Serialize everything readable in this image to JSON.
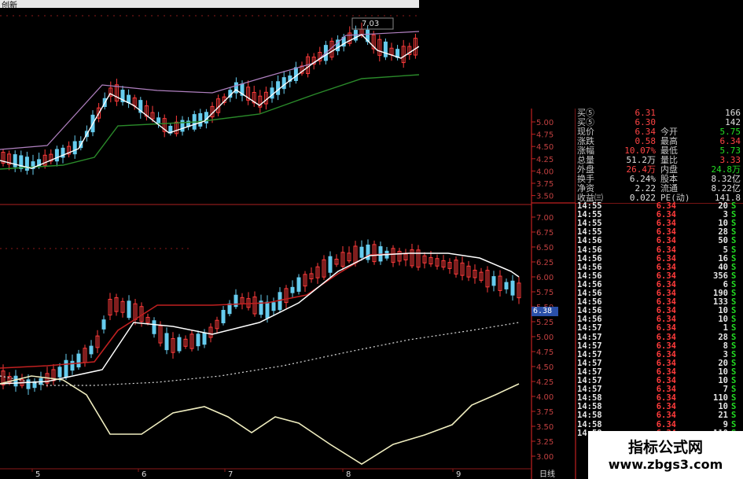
{
  "window": {
    "title": "创新"
  },
  "colors": {
    "up": "#ff3b3b",
    "down": "#66ccee",
    "ma_white": "#ffffff",
    "ma_purple": "#b080c0",
    "ma_green": "#2a8a2a",
    "ma_red": "#c02020",
    "oscillator": "#f0eec0",
    "grid": "#8b1a1a"
  },
  "top_chart": {
    "annotation": "7.03",
    "y_ticks": [
      "5.00",
      "4.75",
      "4.50",
      "4.25",
      "4.00",
      "3.75",
      "3.50"
    ]
  },
  "main_chart": {
    "y_ticks": [
      "7.00",
      "6.75",
      "6.50",
      "6.25",
      "6.00",
      "5.75",
      "5.50",
      "5.25",
      "5.00",
      "4.75",
      "4.50",
      "4.25",
      "4.00",
      "3.75",
      "3.50",
      "3.25",
      "3.00"
    ],
    "price_tag": "6.38",
    "x_labels": [
      "5",
      "6",
      "7",
      "8",
      "9"
    ],
    "period_label": "日线"
  },
  "quote": {
    "rows": [
      {
        "l1": "买⑤",
        "v1": "6.31",
        "v1c": "qv",
        "l2": "",
        "v2": "166",
        "v2c": "qw"
      },
      {
        "l1": "买⑤",
        "v1": "6.30",
        "v1c": "qv",
        "l2": "",
        "v2": "142",
        "v2c": "qw"
      },
      {
        "l1": "现价",
        "v1": "6.34",
        "v1c": "qv",
        "l2": "今开",
        "v2": "5.75",
        "v2c": "qg"
      },
      {
        "l1": "涨跌",
        "v1": "0.58",
        "v1c": "qv",
        "l2": "最高",
        "v2": "6.34",
        "v2c": "qv"
      },
      {
        "l1": "涨幅",
        "v1": "10.07%",
        "v1c": "qv",
        "l2": "最低",
        "v2": "5.73",
        "v2c": "qg"
      },
      {
        "l1": "总量",
        "v1": "51.2万",
        "v1c": "qw",
        "l2": "量比",
        "v2": "3.33",
        "v2c": "qv"
      },
      {
        "l1": "外盘",
        "v1": "26.4万",
        "v1c": "qv",
        "l2": "内盘",
        "v2": "24.8万",
        "v2c": "qg"
      },
      {
        "l1": "换手",
        "v1": "6.24%",
        "v1c": "qw",
        "l2": "股本",
        "v2": "8.32亿",
        "v2c": "qw"
      },
      {
        "l1": "净资",
        "v1": "2.22",
        "v1c": "qw",
        "l2": "流通",
        "v2": "8.22亿",
        "v2c": "qw"
      },
      {
        "l1": "收益㈢",
        "v1": "0.022",
        "v1c": "qw",
        "l2": "PE(动)",
        "v2": "141.8",
        "v2c": "qw"
      }
    ]
  },
  "trades": [
    {
      "time": "14:55",
      "price": "6.34",
      "vol": "20",
      "side": "S"
    },
    {
      "time": "14:55",
      "price": "6.34",
      "vol": "3",
      "side": "S"
    },
    {
      "time": "14:55",
      "price": "6.34",
      "vol": "10",
      "side": "S"
    },
    {
      "time": "14:55",
      "price": "6.34",
      "vol": "28",
      "side": "S"
    },
    {
      "time": "14:56",
      "price": "6.34",
      "vol": "50",
      "side": "S"
    },
    {
      "time": "14:56",
      "price": "6.34",
      "vol": "5",
      "side": "S"
    },
    {
      "time": "14:56",
      "price": "6.34",
      "vol": "16",
      "side": "S"
    },
    {
      "time": "14:56",
      "price": "6.34",
      "vol": "40",
      "side": "S"
    },
    {
      "time": "14:56",
      "price": "6.34",
      "vol": "356",
      "side": "S"
    },
    {
      "time": "14:56",
      "price": "6.34",
      "vol": "6",
      "side": "S"
    },
    {
      "time": "14:56",
      "price": "6.34",
      "vol": "190",
      "side": "S"
    },
    {
      "time": "14:56",
      "price": "6.34",
      "vol": "133",
      "side": "S"
    },
    {
      "time": "14:56",
      "price": "6.34",
      "vol": "10",
      "side": "S"
    },
    {
      "time": "14:56",
      "price": "6.34",
      "vol": "10",
      "side": "S"
    },
    {
      "time": "14:57",
      "price": "6.34",
      "vol": "1",
      "side": "S"
    },
    {
      "time": "14:57",
      "price": "6.34",
      "vol": "28",
      "side": "S"
    },
    {
      "time": "14:57",
      "price": "6.34",
      "vol": "8",
      "side": "S"
    },
    {
      "time": "14:57",
      "price": "6.34",
      "vol": "3",
      "side": "S"
    },
    {
      "time": "14:57",
      "price": "6.34",
      "vol": "20",
      "side": "S"
    },
    {
      "time": "14:57",
      "price": "6.34",
      "vol": "10",
      "side": "S"
    },
    {
      "time": "14:57",
      "price": "6.34",
      "vol": "10",
      "side": "S"
    },
    {
      "time": "14:57",
      "price": "6.34",
      "vol": "7",
      "side": "S"
    },
    {
      "time": "14:58",
      "price": "6.34",
      "vol": "110",
      "side": "S"
    },
    {
      "time": "14:58",
      "price": "6.34",
      "vol": "10",
      "side": "S"
    },
    {
      "time": "14:58",
      "price": "6.34",
      "vol": "21",
      "side": "S"
    },
    {
      "time": "14:58",
      "price": "6.34",
      "vol": "9",
      "side": "S"
    },
    {
      "time": "14:58",
      "price": "6.34",
      "vol": "110",
      "side": "S"
    }
  ],
  "watermark": {
    "line1": "指标公式网",
    "line2": "www.zbgs3.com"
  }
}
